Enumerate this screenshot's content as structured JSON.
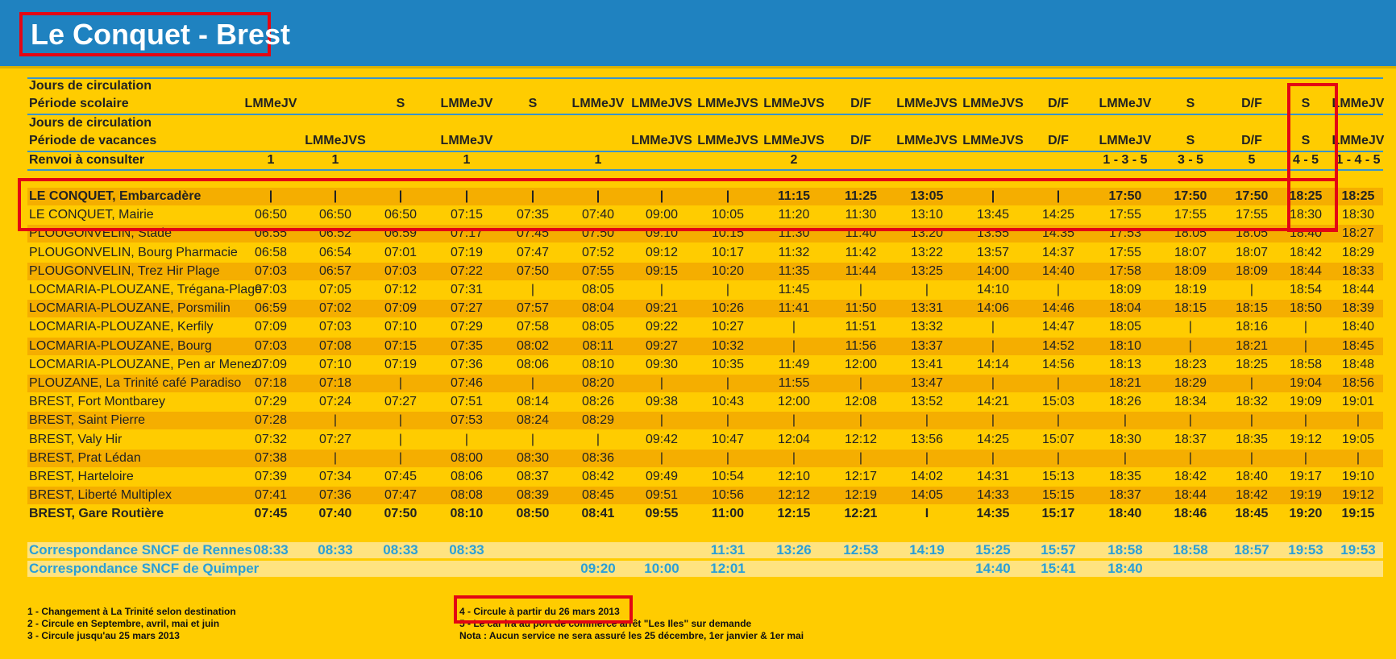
{
  "title": "Le Conquet - Brest",
  "headers": {
    "scolaire_line1": "Jours de circulation",
    "scolaire_line2": "Période scolaire",
    "vacances_line1": "Jours de circulation",
    "vacances_line2": "Période de vacances",
    "renvoi": "Renvoi à consulter"
  },
  "trips": [
    {
      "scolaire": "LMMeJV",
      "vacances": "",
      "renvoi": "1"
    },
    {
      "scolaire": "",
      "vacances": "LMMeJVS",
      "renvoi": "1"
    },
    {
      "scolaire": "S",
      "vacances": "",
      "renvoi": ""
    },
    {
      "scolaire": "LMMeJV",
      "vacances": "LMMeJV",
      "renvoi": "1"
    },
    {
      "scolaire": "S",
      "vacances": "",
      "renvoi": ""
    },
    {
      "scolaire": "LMMeJV",
      "vacances": "",
      "renvoi": "1"
    },
    {
      "scolaire": "LMMeJVS",
      "vacances": "LMMeJVS",
      "renvoi": ""
    },
    {
      "scolaire": "LMMeJVS",
      "vacances": "LMMeJVS",
      "renvoi": ""
    },
    {
      "scolaire": "LMMeJVS",
      "vacances": "LMMeJVS",
      "renvoi": "2"
    },
    {
      "scolaire": "D/F",
      "vacances": "D/F",
      "renvoi": ""
    },
    {
      "scolaire": "LMMeJVS",
      "vacances": "LMMeJVS",
      "renvoi": ""
    },
    {
      "scolaire": "LMMeJVS",
      "vacances": "LMMeJVS",
      "renvoi": ""
    },
    {
      "scolaire": "D/F",
      "vacances": "D/F",
      "renvoi": ""
    },
    {
      "scolaire": "LMMeJV",
      "vacances": "LMMeJV",
      "renvoi": "1 - 3 - 5"
    },
    {
      "scolaire": "S",
      "vacances": "S",
      "renvoi": "3 - 5"
    },
    {
      "scolaire": "D/F",
      "vacances": "D/F",
      "renvoi": "5"
    },
    {
      "scolaire": "S",
      "vacances": "S",
      "renvoi": "4 - 5"
    },
    {
      "scolaire": "LMMeJV",
      "vacances": "LMMeJV",
      "renvoi": "1 - 4 - 5"
    }
  ],
  "stops": [
    {
      "name": "LE CONQUET, Embarcadère",
      "bold": true,
      "times": [
        "|",
        "|",
        "|",
        "|",
        "|",
        "|",
        "|",
        "|",
        "11:15",
        "11:25",
        "13:05",
        "|",
        "|",
        "17:50",
        "17:50",
        "17:50",
        "18:25",
        "18:25"
      ]
    },
    {
      "name": "LE CONQUET, Mairie",
      "bold": false,
      "times": [
        "06:50",
        "06:50",
        "06:50",
        "07:15",
        "07:35",
        "07:40",
        "09:00",
        "10:05",
        "11:20",
        "11:30",
        "13:10",
        "13:45",
        "14:25",
        "17:55",
        "17:55",
        "17:55",
        "18:30",
        "18:30"
      ]
    },
    {
      "name": "PLOUGONVELIN, Stade",
      "bold": false,
      "times": [
        "06:55",
        "06:52",
        "06:59",
        "07:17",
        "07:45",
        "07:50",
        "09:10",
        "10:15",
        "11:30",
        "11:40",
        "13:20",
        "13:55",
        "14:35",
        "17:53",
        "18:05",
        "18:05",
        "18:40",
        "18:27"
      ]
    },
    {
      "name": "PLOUGONVELIN, Bourg Pharmacie",
      "bold": false,
      "times": [
        "06:58",
        "06:54",
        "07:01",
        "07:19",
        "07:47",
        "07:52",
        "09:12",
        "10:17",
        "11:32",
        "11:42",
        "13:22",
        "13:57",
        "14:37",
        "17:55",
        "18:07",
        "18:07",
        "18:42",
        "18:29"
      ]
    },
    {
      "name": "PLOUGONVELIN, Trez Hir Plage",
      "bold": false,
      "times": [
        "07:03",
        "06:57",
        "07:03",
        "07:22",
        "07:50",
        "07:55",
        "09:15",
        "10:20",
        "11:35",
        "11:44",
        "13:25",
        "14:00",
        "14:40",
        "17:58",
        "18:09",
        "18:09",
        "18:44",
        "18:33"
      ]
    },
    {
      "name": "LOCMARIA-PLOUZANE, Trégana-Plage",
      "bold": false,
      "times": [
        "07:03",
        "07:05",
        "07:12",
        "07:31",
        "|",
        "08:05",
        "|",
        "|",
        "11:45",
        "|",
        "|",
        "14:10",
        "|",
        "18:09",
        "18:19",
        "|",
        "18:54",
        "18:44"
      ]
    },
    {
      "name": "LOCMARIA-PLOUZANE, Porsmilin",
      "bold": false,
      "times": [
        "06:59",
        "07:02",
        "07:09",
        "07:27",
        "07:57",
        "08:04",
        "09:21",
        "10:26",
        "11:41",
        "11:50",
        "13:31",
        "14:06",
        "14:46",
        "18:04",
        "18:15",
        "18:15",
        "18:50",
        "18:39"
      ]
    },
    {
      "name": "LOCMARIA-PLOUZANE, Kerfily",
      "bold": false,
      "times": [
        "07:09",
        "07:03",
        "07:10",
        "07:29",
        "07:58",
        "08:05",
        "09:22",
        "10:27",
        "|",
        "11:51",
        "13:32",
        "|",
        "14:47",
        "18:05",
        "|",
        "18:16",
        "|",
        "18:40"
      ]
    },
    {
      "name": "LOCMARIA-PLOUZANE, Bourg",
      "bold": false,
      "times": [
        "07:03",
        "07:08",
        "07:15",
        "07:35",
        "08:02",
        "08:11",
        "09:27",
        "10:32",
        "|",
        "11:56",
        "13:37",
        "|",
        "14:52",
        "18:10",
        "|",
        "18:21",
        "|",
        "18:45"
      ]
    },
    {
      "name": "LOCMARIA-PLOUZANE, Pen ar Menez",
      "bold": false,
      "times": [
        "07:09",
        "07:10",
        "07:19",
        "07:36",
        "08:06",
        "08:10",
        "09:30",
        "10:35",
        "11:49",
        "12:00",
        "13:41",
        "14:14",
        "14:56",
        "18:13",
        "18:23",
        "18:25",
        "18:58",
        "18:48"
      ]
    },
    {
      "name": "PLOUZANE, La Trinité café Paradiso",
      "bold": false,
      "times": [
        "07:18",
        "07:18",
        "|",
        "07:46",
        "|",
        "08:20",
        "|",
        "|",
        "11:55",
        "|",
        "13:47",
        "|",
        "|",
        "18:21",
        "18:29",
        "|",
        "19:04",
        "18:56"
      ]
    },
    {
      "name": "BREST, Fort Montbarey",
      "bold": false,
      "times": [
        "07:29",
        "07:24",
        "07:27",
        "07:51",
        "08:14",
        "08:26",
        "09:38",
        "10:43",
        "12:00",
        "12:08",
        "13:52",
        "14:21",
        "15:03",
        "18:26",
        "18:34",
        "18:32",
        "19:09",
        "19:01"
      ]
    },
    {
      "name": "BREST, Saint Pierre",
      "bold": false,
      "times": [
        "07:28",
        "|",
        "|",
        "07:53",
        "08:24",
        "08:29",
        "|",
        "|",
        "|",
        "|",
        "|",
        "|",
        "|",
        "|",
        "|",
        "|",
        "|",
        "|"
      ]
    },
    {
      "name": "BREST, Valy Hir",
      "bold": false,
      "times": [
        "07:32",
        "07:27",
        "|",
        "|",
        "|",
        "|",
        "09:42",
        "10:47",
        "12:04",
        "12:12",
        "13:56",
        "14:25",
        "15:07",
        "18:30",
        "18:37",
        "18:35",
        "19:12",
        "19:05"
      ]
    },
    {
      "name": "BREST, Prat Lédan",
      "bold": false,
      "times": [
        "07:38",
        "|",
        "|",
        "08:00",
        "08:30",
        "08:36",
        "|",
        "|",
        "|",
        "|",
        "|",
        "|",
        "|",
        "|",
        "|",
        "|",
        "|",
        "|"
      ]
    },
    {
      "name": "BREST, Harteloire",
      "bold": false,
      "times": [
        "07:39",
        "07:34",
        "07:45",
        "08:06",
        "08:37",
        "08:42",
        "09:49",
        "10:54",
        "12:10",
        "12:17",
        "14:02",
        "14:31",
        "15:13",
        "18:35",
        "18:42",
        "18:40",
        "19:17",
        "19:10"
      ]
    },
    {
      "name": "BREST, Liberté Multiplex",
      "bold": false,
      "times": [
        "07:41",
        "07:36",
        "07:47",
        "08:08",
        "08:39",
        "08:45",
        "09:51",
        "10:56",
        "12:12",
        "12:19",
        "14:05",
        "14:33",
        "15:15",
        "18:37",
        "18:44",
        "18:42",
        "19:19",
        "19:12"
      ]
    },
    {
      "name": "BREST, Gare Routière",
      "bold": true,
      "times": [
        "07:45",
        "07:40",
        "07:50",
        "08:10",
        "08:50",
        "08:41",
        "09:55",
        "11:00",
        "12:15",
        "12:21",
        "I",
        "14:35",
        "15:17",
        "18:40",
        "18:46",
        "18:45",
        "19:20",
        "19:15"
      ]
    }
  ],
  "correspondances": [
    {
      "label": "Correspondance SNCF de Rennes",
      "times": [
        "08:33",
        "08:33",
        "08:33",
        "08:33",
        "",
        "",
        "",
        "11:31",
        "13:26",
        "12:53",
        "14:19",
        "15:25",
        "15:57",
        "18:58",
        "18:58",
        "18:57",
        "19:53",
        "19:53"
      ]
    },
    {
      "label": "Correspondance SNCF de Quimper",
      "times": [
        "",
        "",
        "",
        "",
        "",
        "09:20",
        "10:00",
        "12:01",
        "",
        "",
        "",
        "14:40",
        "15:41",
        "18:40",
        "",
        "",
        "",
        ""
      ]
    }
  ],
  "notes_left": [
    "1 - Changement à La Trinité selon destination",
    "2 - Circule en Septembre, avril, mai et juin",
    "3 - Circule jusqu'au 25 mars 2013"
  ],
  "notes_right": [
    "4 - Circule à partir du 26 mars 2013",
    "5 - Le car ira au port de commerce arrêt \"Les Iles\" sur demande",
    "Nota : Aucun service ne sera assuré les 25 décembre, 1er janvier & 1er mai"
  ],
  "colors": {
    "background": "#ffcc00",
    "header": "#1f82c0",
    "band": "#f5ae00",
    "correspondance": "#2a9fd8",
    "highlight": "#e30613"
  }
}
